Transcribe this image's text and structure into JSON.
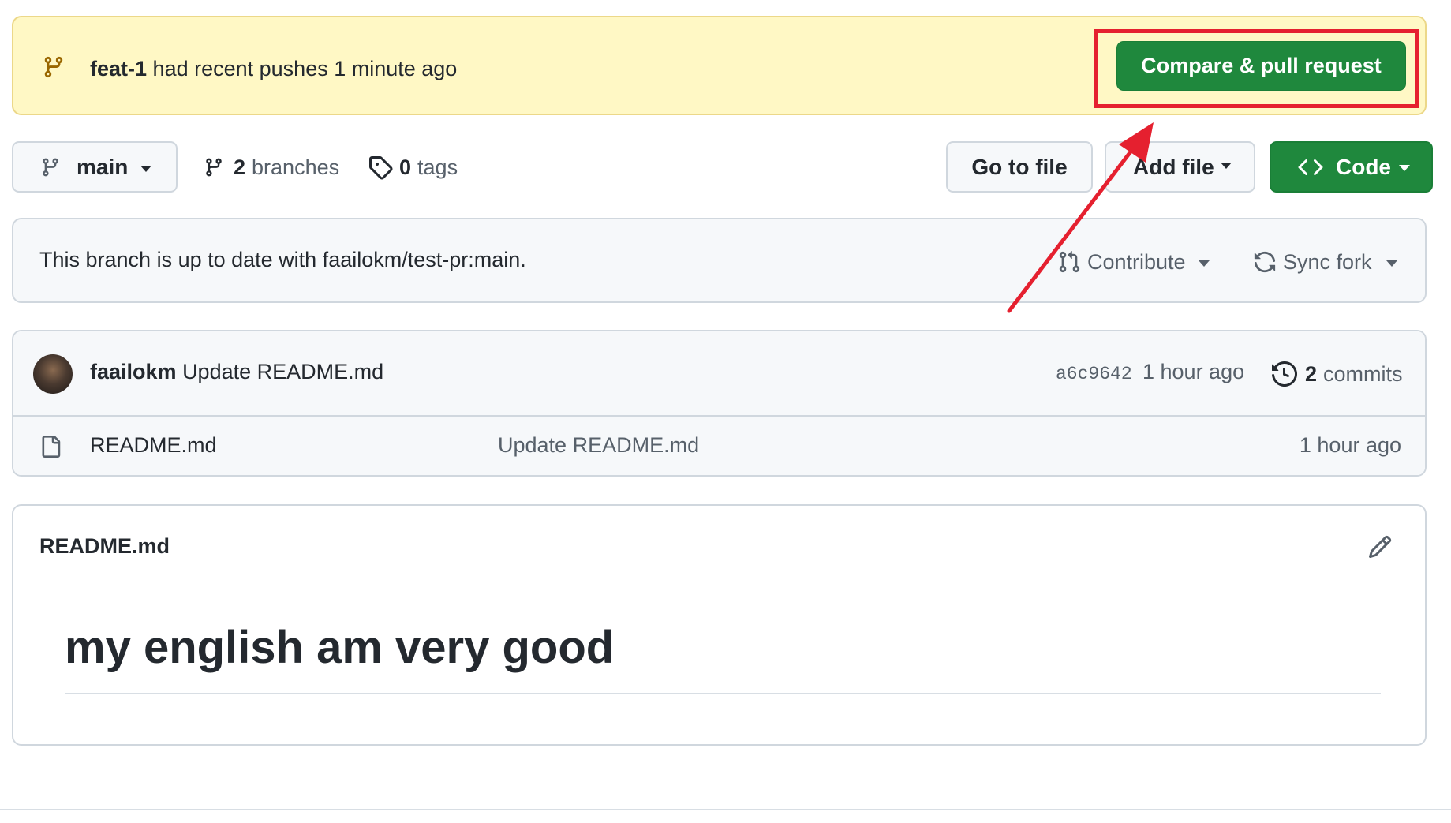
{
  "banner": {
    "branch": "feat-1",
    "message": "had recent pushes 1 minute ago",
    "compare_button": "Compare & pull request"
  },
  "toolbar": {
    "branch_select": "main",
    "branches_count": "2",
    "branches_label": "branches",
    "tags_count": "0",
    "tags_label": "tags",
    "go_to_file": "Go to file",
    "add_file": "Add file",
    "code": "Code"
  },
  "status": {
    "text": "This branch is up to date with faailokm/test-pr:main.",
    "contribute": "Contribute",
    "sync_fork": "Sync fork"
  },
  "commit": {
    "author": "faailokm",
    "message": "Update README.md",
    "sha": "a6c9642",
    "time": "1 hour ago",
    "commits_count": "2",
    "commits_label": "commits"
  },
  "files": [
    {
      "name": "README.md",
      "message": "Update README.md",
      "time": "1 hour ago"
    }
  ],
  "readme": {
    "filename": "README.md",
    "heading": "my english am very good"
  },
  "colors": {
    "banner_bg": "#fff8c5",
    "primary_green": "#1f883d",
    "annotation_red": "#e5202f"
  },
  "icons": [
    "git-branch-icon",
    "tag-icon",
    "code-icon",
    "git-pull-request-icon",
    "sync-icon",
    "history-icon",
    "file-icon",
    "pencil-icon"
  ]
}
